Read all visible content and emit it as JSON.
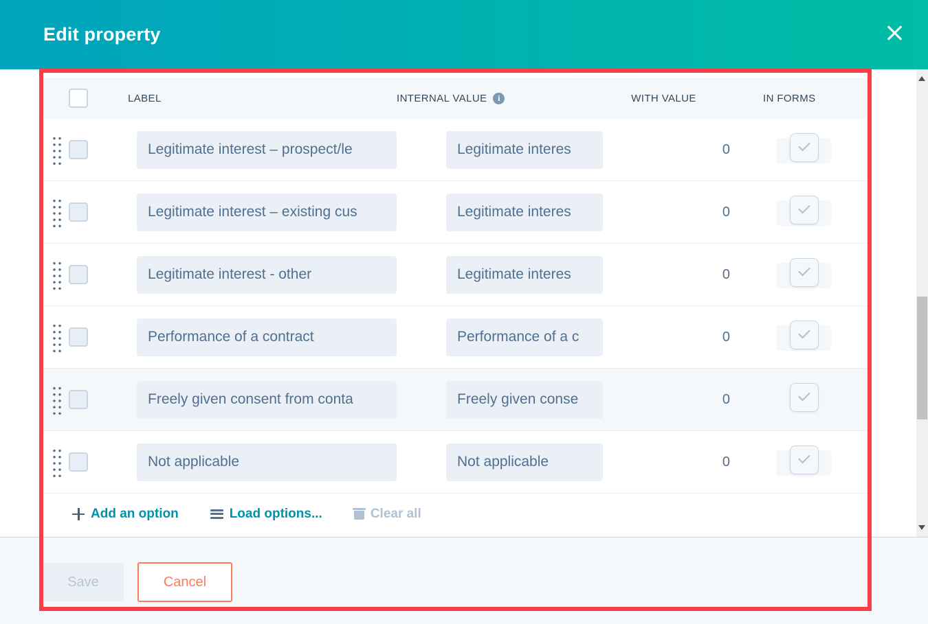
{
  "header": {
    "title": "Edit property"
  },
  "table": {
    "columns": {
      "label": "LABEL",
      "internal_value": "INTERNAL VALUE",
      "with_value": "WITH VALUE",
      "in_forms": "IN FORMS"
    },
    "rows": [
      {
        "label": "Legitimate interest – prospect/le",
        "internal_value": "Legitimate interes",
        "with_value": "0",
        "in_forms_checked": true
      },
      {
        "label": "Legitimate interest – existing cus",
        "internal_value": "Legitimate interes",
        "with_value": "0",
        "in_forms_checked": true
      },
      {
        "label": "Legitimate interest - other",
        "internal_value": "Legitimate interes",
        "with_value": "0",
        "in_forms_checked": true
      },
      {
        "label": "Performance of a contract",
        "internal_value": "Performance of a c",
        "with_value": "0",
        "in_forms_checked": true
      },
      {
        "label": "Freely given consent from conta",
        "internal_value": "Freely given conse",
        "with_value": "0",
        "in_forms_checked": true
      },
      {
        "label": "Not applicable",
        "internal_value": "Not applicable",
        "with_value": "0",
        "in_forms_checked": true
      }
    ]
  },
  "actions": {
    "add_option": "Add an option",
    "load_options": "Load options...",
    "clear_all": "Clear all"
  },
  "footer": {
    "save": "Save",
    "cancel": "Cancel"
  },
  "icons": {
    "info": "i"
  },
  "colors": {
    "header_gradient_from": "#00a4bd",
    "header_gradient_to": "#00bda5",
    "link_teal": "#0091ae",
    "disabled_text": "#b0c1d4",
    "input_bg": "#eaf0f6",
    "input_text": "#516f90",
    "cancel_orange": "#ff7a59",
    "annotation_red": "#f83e46"
  }
}
